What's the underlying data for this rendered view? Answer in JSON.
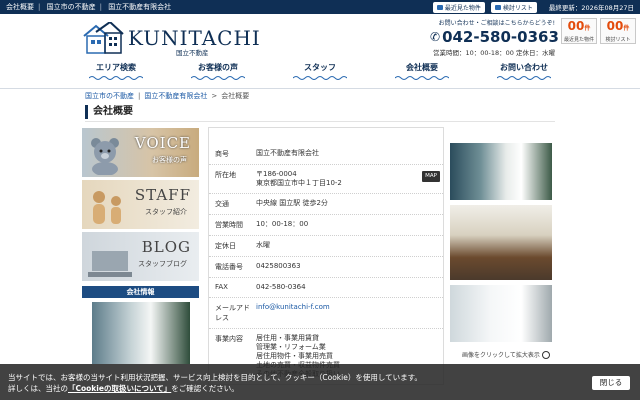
{
  "topbar": {
    "crumbs": [
      "会社概要",
      "国立市の不動産",
      "国立不動産有限会社"
    ],
    "recent_label": "最近見た物件",
    "fav_label": "検討リスト",
    "date_text": "最終更新：2026年08月27日"
  },
  "header": {
    "logo_name": "KUNITACHI",
    "logo_sub": "国立不動産",
    "contact_note": "お問い合わせ・ご相談はこちらからどうぞ!",
    "tel": "042-580-0363",
    "hours": "営業時間：10：00-18：00 定休日：水曜",
    "counters": [
      {
        "num": "00",
        "unit": "件",
        "label": "最近見た物件"
      },
      {
        "num": "00",
        "unit": "件",
        "label": "検討リスト"
      }
    ]
  },
  "nav": [
    "エリア検索",
    "お客様の声",
    "スタッフ",
    "会社概要",
    "お問い合わせ"
  ],
  "breadcrumb": {
    "items": [
      "国立市の不動産",
      "国立不動産有限会社"
    ],
    "current": "会社概要"
  },
  "page_title": "会社概要",
  "sidebar": {
    "voice_title": "VOICE",
    "voice_sub": "お客様の声",
    "staff_title": "STAFF",
    "staff_sub": "スタッフ紹介",
    "blog_title": "BLOG",
    "blog_sub": "スタッフブログ",
    "info_head": "会社情報"
  },
  "company": {
    "rows": [
      {
        "k": "商号",
        "v": "国立不動産有限会社"
      },
      {
        "k": "所在地",
        "v": "〒186-0004\n東京都国立市中１丁目10-2"
      },
      {
        "k": "交通",
        "v": "中央線 国立駅 徒歩2分"
      },
      {
        "k": "営業時間",
        "v": "10：00-18：00"
      },
      {
        "k": "定休日",
        "v": "水曜"
      },
      {
        "k": "電話番号",
        "v": "0425800363"
      },
      {
        "k": "FAX",
        "v": "042-580-0364"
      },
      {
        "k": "メールアドレス",
        "v": "info@kunitachi-f.com"
      },
      {
        "k": "事業内容",
        "v": "居住用・事業用賃貸\n管理業・リフォーム業\n居住用物件・事業用売買\n土地の売買・収益物件売買\nその他不動産全般取り扱い"
      }
    ],
    "map_label": "MAP"
  },
  "photo_caption": "画像をクリックして拡大表示",
  "cookie": {
    "line1": "当サイトでは、お客様の当サイト利用状況把握、サービス向上検討を目的として、クッキー（Cookie）を使用しています。",
    "line2_pre": "詳しくは、当社の",
    "line2_link": "「Cookieの取扱いについて」",
    "line2_post": "をご確認ください。",
    "close_label": "閉じる"
  }
}
